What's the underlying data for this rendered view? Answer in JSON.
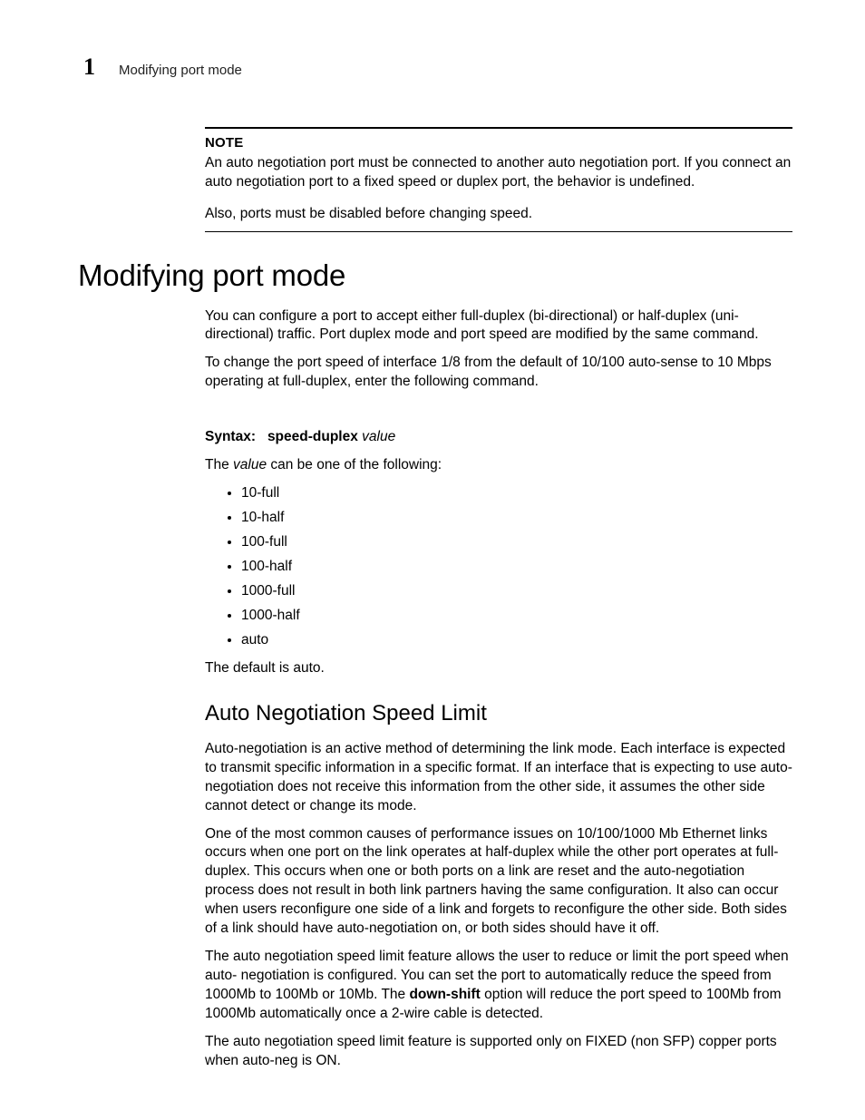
{
  "header": {
    "chapter_number": "1",
    "running_title": "Modifying port mode"
  },
  "note": {
    "label": "NOTE",
    "body": " An auto negotiation port must be connected to another auto negotiation port. If you connect an auto negotiation port to a fixed speed or duplex port, the behavior is undefined.",
    "after": "Also, ports must be disabled before changing speed."
  },
  "section": {
    "title": "Modifying port mode",
    "para1": "You can configure a port to accept either full-duplex (bi-directional) or half-duplex (uni-directional) traffic. Port duplex mode and port speed are modified by the same command.",
    "para2": "To change the port speed of interface 1/8 from the default of 10/100 auto-sense to 10 Mbps operating at full-duplex, enter the following command.",
    "syntax_prefix": "Syntax:",
    "syntax_cmd": "speed-duplex",
    "syntax_arg": "value",
    "syntax_intro_pre": "The ",
    "syntax_intro_arg": "value",
    "syntax_intro_post": " can be one of the following:",
    "values": [
      "10-full",
      "10-half",
      "100-full",
      "100-half",
      "1000-full",
      "1000-half",
      "auto"
    ],
    "default_line": "The default is auto."
  },
  "subsection": {
    "title": "Auto Negotiation Speed Limit",
    "para1": "Auto-negotiation is an active method of determining the link mode. Each interface is expected to transmit specific information in a specific format. If an interface that is expecting to use auto-negotiation does not receive this information from the other side, it assumes the other side cannot detect or change its mode.",
    "para2": "One of the most common causes of performance issues on 10/100/1000 Mb Ethernet links occurs when one port on the link operates at half-duplex while the other port operates at full-duplex. This occurs when one or both ports on a link are reset and the auto-negotiation process does not result in both link partners having the same configuration. It also can occur when users reconfigure one side of a link and forgets to reconfigure the other side. Both sides of a link should have auto-negotiation on, or both sides should have it off.",
    "para3_pre": "The auto negotiation speed limit feature allows the user to reduce or limit the port speed when auto- negotiation is configured. You can set the port to automatically reduce the speed from 1000Mb to 100Mb or 10Mb. The ",
    "para3_bold": "down-shift",
    "para3_post": " option will reduce the port speed to 100Mb from 1000Mb automatically once a 2-wire cable is detected.",
    "para4": "The auto negotiation speed limit feature is supported only on FIXED (non SFP) copper ports when auto-neg is ON."
  }
}
